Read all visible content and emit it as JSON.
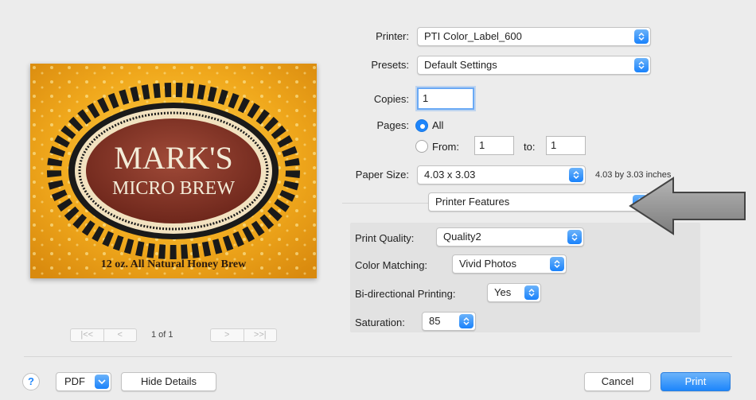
{
  "printer": {
    "label": "Printer:",
    "value": "PTI Color_Label_600"
  },
  "presets": {
    "label": "Presets:",
    "value": "Default Settings"
  },
  "copies": {
    "label": "Copies:",
    "value": "1"
  },
  "pages": {
    "label": "Pages:",
    "all_label": "All",
    "from_label": "From:",
    "from_value": "1",
    "to_label": "to:",
    "to_value": "1"
  },
  "paper_size": {
    "label": "Paper Size:",
    "value": "4.03 x 3.03",
    "description": "4.03 by 3.03 inches"
  },
  "section": {
    "value": "Printer Features"
  },
  "features": {
    "print_quality": {
      "label": "Print Quality:",
      "value": "Quality2"
    },
    "color_matching": {
      "label": "Color Matching:",
      "value": "Vivid Photos"
    },
    "bidirectional": {
      "label": "Bi-directional Printing:",
      "value": "Yes"
    },
    "saturation": {
      "label": "Saturation:",
      "value": "85"
    }
  },
  "preview": {
    "title_line1": "MARK'S",
    "title_line2": "MICRO BREW",
    "caption": "12 oz. All Natural Honey Brew"
  },
  "pager": {
    "first": "|<<",
    "prev": "<",
    "page_text": "1 of 1",
    "next": ">",
    "last": ">>|"
  },
  "footer": {
    "help": "?",
    "pdf": "PDF",
    "hide_details": "Hide Details",
    "cancel": "Cancel",
    "print": "Print"
  },
  "colors": {
    "accent": "#1d85fb",
    "label_gold": "#e8a317",
    "label_maroon": "#7a2a20"
  }
}
